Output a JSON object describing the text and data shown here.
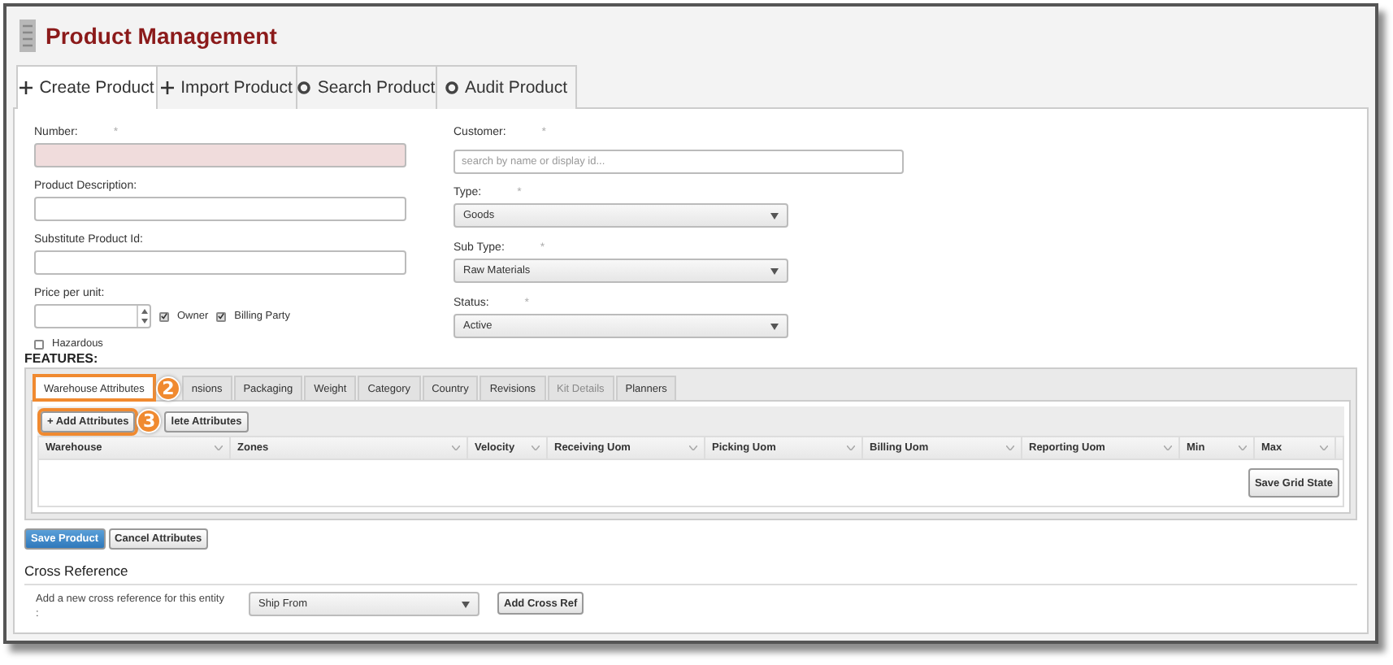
{
  "title": "Product Management",
  "tabs": [
    {
      "label": "Create Product",
      "kind": "add",
      "selected": true
    },
    {
      "label": "Import Product",
      "kind": "add",
      "selected": false
    },
    {
      "label": "Search Product",
      "kind": "action",
      "selected": false
    },
    {
      "label": "Audit Product",
      "kind": "action",
      "selected": false
    }
  ],
  "left_fields": [
    {
      "label": "Number:",
      "required_mark": "*",
      "kind": "text",
      "invalid": true
    },
    {
      "label": "Product Description:",
      "kind": "text",
      "invalid": false
    },
    {
      "label": "Substitute Product Id:",
      "kind": "text",
      "invalid": false
    },
    {
      "label": "Price per unit:",
      "kind": "price",
      "checkboxes": [
        {
          "label": "Owner",
          "checked": true
        },
        {
          "label": "Billing Party",
          "checked": true
        }
      ]
    }
  ],
  "hazardous": {
    "label": "Hazardous",
    "checked": false
  },
  "right_fields": [
    {
      "label": "Customer:",
      "required_mark": "*",
      "kind": "search",
      "placeholder": "search by name or display id..."
    },
    {
      "label": "Type:",
      "required_mark": "*",
      "kind": "select",
      "value": "Goods"
    },
    {
      "label": "Sub Type:",
      "required_mark": "*",
      "kind": "select",
      "value": "Raw Materials"
    },
    {
      "label": "Status:",
      "required_mark": "*",
      "kind": "select",
      "value": "Active"
    }
  ],
  "features": {
    "heading": "FEATURES:",
    "tabs": [
      {
        "label": "Warehouse Attributes",
        "selected": true,
        "disabled": false,
        "callout": "2"
      },
      {
        "label": "nsions",
        "selected": false,
        "disabled": false
      },
      {
        "label": "Packaging",
        "selected": false,
        "disabled": false
      },
      {
        "label": "Weight",
        "selected": false,
        "disabled": false
      },
      {
        "label": "Category",
        "selected": false,
        "disabled": false
      },
      {
        "label": "Country",
        "selected": false,
        "disabled": false
      },
      {
        "label": "Revisions",
        "selected": false,
        "disabled": false
      },
      {
        "label": "Kit Details",
        "selected": false,
        "disabled": true
      },
      {
        "label": "Planners",
        "selected": false,
        "disabled": false
      }
    ],
    "toolbar": [
      {
        "label": "+ Add Attributes",
        "callout": "3"
      },
      {
        "label": "lete Attributes"
      }
    ],
    "columns": [
      "Warehouse",
      "Zones",
      "Velocity",
      "Receiving Uom",
      "Picking Uom",
      "Billing Uom",
      "Reporting Uom",
      "Min",
      "Max"
    ],
    "grid_button": "Save Grid State"
  },
  "actions": [
    {
      "label": "Save Product",
      "primary": true
    },
    {
      "label": "Cancel Attributes",
      "primary": false
    }
  ],
  "cross_reference": {
    "heading": "Cross Reference",
    "text": "Add a new cross reference for this entity",
    "text_line_2": ":",
    "select_value": "Ship From",
    "button": "Add Cross Ref"
  }
}
